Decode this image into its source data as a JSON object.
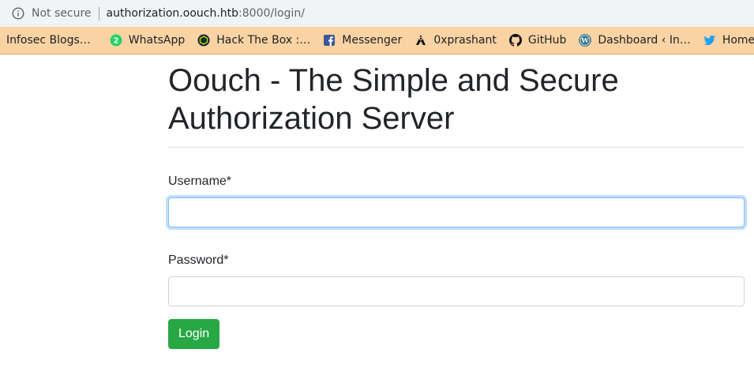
{
  "browser": {
    "security_label": "Not secure",
    "url_host": "authorization.oouch.htb",
    "url_rest": ":8000/login/"
  },
  "bookmarks": [
    {
      "label": "Infosec Blogs…",
      "icon": "none"
    },
    {
      "label": "WhatsApp",
      "icon": "whatsapp-icon"
    },
    {
      "label": "Hack The Box :…",
      "icon": "hackthebox-icon"
    },
    {
      "label": "Messenger",
      "icon": "facebook-icon"
    },
    {
      "label": "0xprashant",
      "icon": "hacker-icon"
    },
    {
      "label": "GitHub",
      "icon": "github-icon"
    },
    {
      "label": "Dashboard ‹ In…",
      "icon": "wordpress-icon"
    },
    {
      "label": "Home /",
      "icon": "twitter-icon"
    }
  ],
  "page": {
    "title": "Oouch - The Simple and Secure Authorization Server",
    "username_label": "Username*",
    "username_value": "",
    "password_label": "Password*",
    "password_value": "",
    "login_label": "Login"
  },
  "colors": {
    "bookmarks_bg": "#fad3a4",
    "login_button": "#28a745",
    "focus_ring": "#80bdff"
  }
}
